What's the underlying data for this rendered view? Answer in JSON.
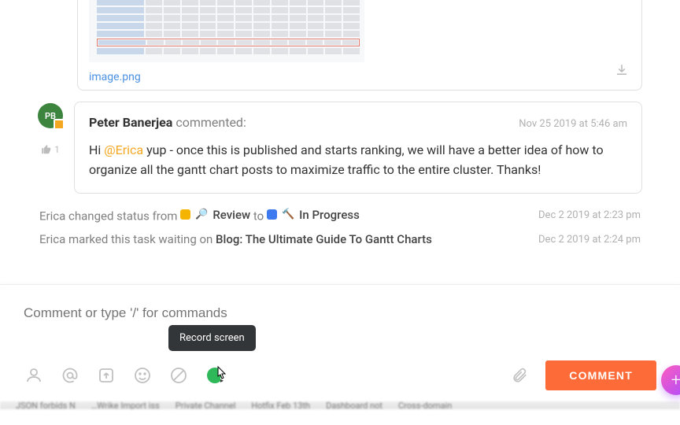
{
  "attachment": {
    "filename": "image.png"
  },
  "comment": {
    "avatar_initials": "PB",
    "author": "Peter Banerjea",
    "action": "commented:",
    "timestamp": "Nov 25 2019 at 5:46 am",
    "like_count": "1",
    "body_pre": "Hi ",
    "mention": "@Erica",
    "body_post": " yup - once this is published and starts ranking, we will have a better idea of how to organize all the gantt chart posts to maximize traffic to the entire cluster. Thanks!"
  },
  "activity": {
    "status_change": {
      "who": "Erica",
      "verb": "changed status from",
      "from_label": "Review",
      "to_word": "to",
      "to_label": "In Progress",
      "timestamp": "Dec 2 2019 at 2:23 pm"
    },
    "waiting": {
      "who": "Erica",
      "verb": "marked this task waiting on",
      "target": "Blog: The Ultimate Guide To Gantt Charts",
      "timestamp": "Dec 2 2019 at 2:24 pm"
    }
  },
  "composer": {
    "placeholder": "Comment or type '/' for commands",
    "tooltip": "Record screen",
    "submit_label": "COMMENT"
  },
  "taskbar": {
    "items": [
      "JSON forbids N",
      "…Wrike Import iss",
      "Private Channel",
      "Hotfix Feb 13th",
      "Dashboard not",
      "Cross-domain"
    ]
  }
}
